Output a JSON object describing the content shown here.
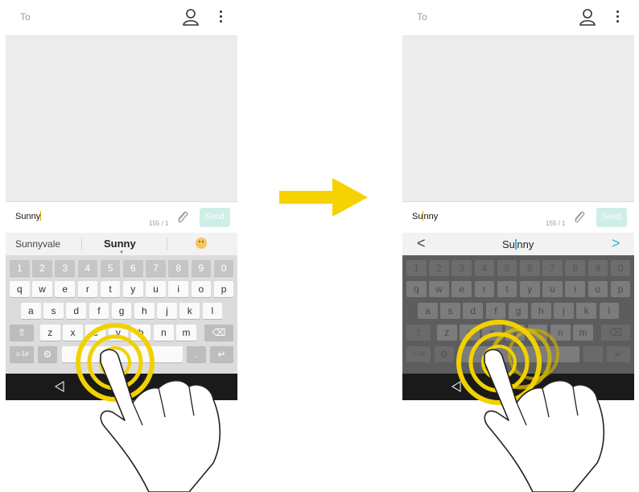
{
  "left_phone": {
    "to_label": "To",
    "compose_text": "Sunny",
    "counter": "155 / 1",
    "send_label": "Send",
    "suggestions": {
      "left": "Sunnyvale",
      "center": "Sunny"
    }
  },
  "right_phone": {
    "to_label": "To",
    "compose_before": "Su",
    "compose_after": "nny",
    "counter": "155 / 1",
    "send_label": "Send",
    "cursor_nav": {
      "prev": "<",
      "word_before": "Su",
      "word_after": "nny",
      "next": ">"
    }
  },
  "keyboard": {
    "numbers": [
      "1",
      "2",
      "3",
      "4",
      "5",
      "6",
      "7",
      "8",
      "9",
      "0"
    ],
    "row1": [
      "q",
      "w",
      "e",
      "r",
      "t",
      "y",
      "u",
      "i",
      "o",
      "p"
    ],
    "row2": [
      "a",
      "s",
      "d",
      "f",
      "g",
      "h",
      "j",
      "k",
      "l"
    ],
    "row3": [
      "z",
      "x",
      "c",
      "v",
      "b",
      "n",
      "m"
    ],
    "symbols_key": "☺1#",
    "shift_key": "⇧",
    "delete_key": "⌫",
    "settings_key": "⚙",
    "enter_key": "↵",
    "dot_key": "."
  },
  "colors": {
    "arrow": "#f5d200",
    "ring": "#f2d100",
    "send": "#cfeee7",
    "nav_arrow": "#2ab6d6"
  },
  "icons": {
    "contact": "person-outline-icon",
    "menu": "kebab-menu-icon",
    "attach": "paperclip-icon",
    "back": "back-triangle-icon"
  }
}
